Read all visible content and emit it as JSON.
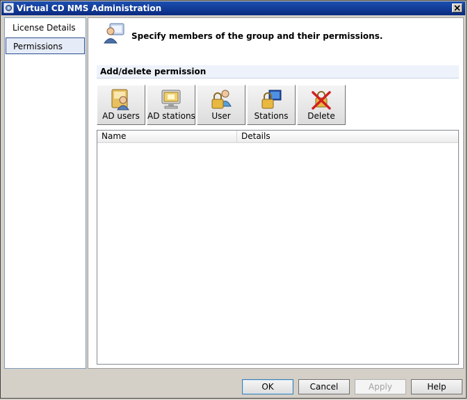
{
  "window": {
    "title": "Virtual CD NMS Administration"
  },
  "nav": {
    "items": [
      {
        "label": "License Details"
      },
      {
        "label": "Permissions"
      }
    ]
  },
  "header": {
    "text": "Specify members of the group and their permissions."
  },
  "group": {
    "title": "Add/delete permission"
  },
  "toolbar": {
    "ad_users": "AD users",
    "ad_stations": "AD stations",
    "user": "User",
    "stations": "Stations",
    "delete": "Delete"
  },
  "list": {
    "columns": [
      "Name",
      "Details"
    ],
    "rows": []
  },
  "buttons": {
    "ok": "OK",
    "cancel": "Cancel",
    "apply": "Apply",
    "help": "Help"
  },
  "colors": {
    "title_bar": "#0a2a80",
    "accent": "#2a4b8c"
  }
}
